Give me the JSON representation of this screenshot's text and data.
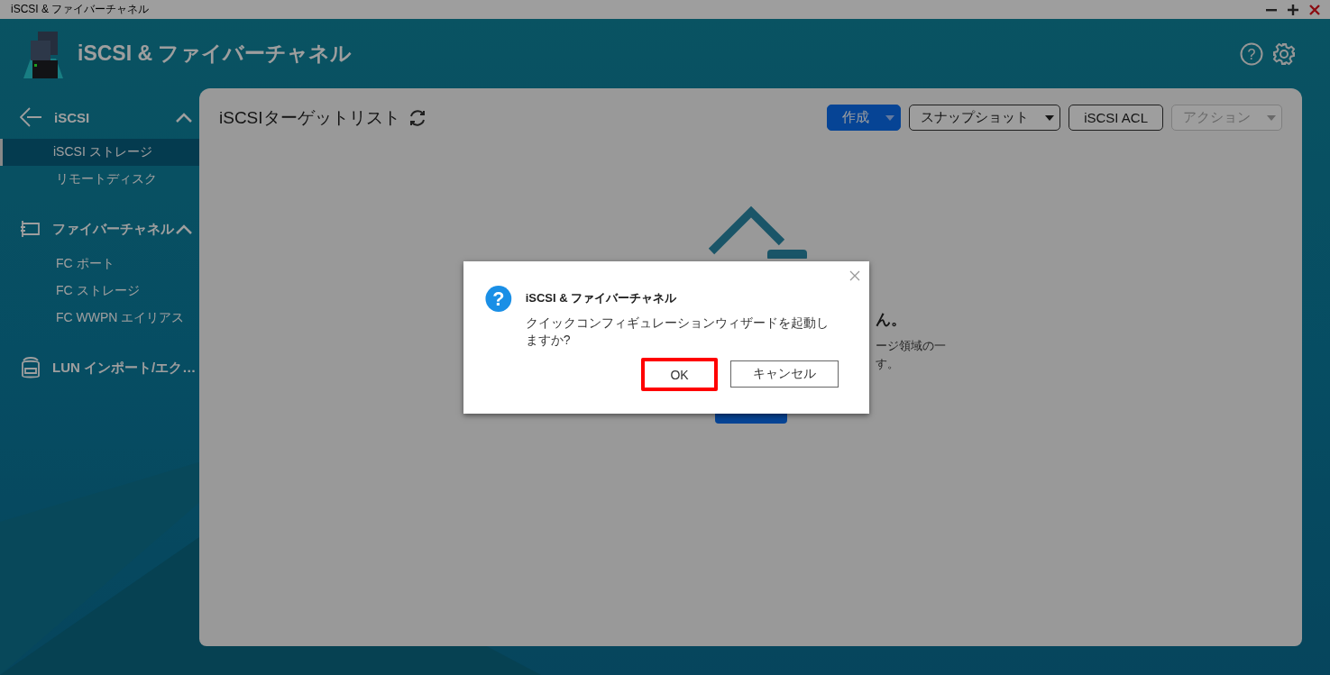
{
  "window": {
    "title": "iSCSI & ファイバーチャネル"
  },
  "app_header": {
    "title": "iSCSI & ファイバーチャネル",
    "help_glyph": "?"
  },
  "sidebar": {
    "groups": [
      {
        "label": "iSCSI",
        "expanded": true,
        "items": [
          {
            "label": "iSCSI ストレージ",
            "selected": true
          },
          {
            "label": "リモートディスク",
            "selected": false
          }
        ]
      },
      {
        "label": "ファイバーチャネル",
        "expanded": true,
        "items": [
          {
            "label": "FC ポート",
            "selected": false
          },
          {
            "label": "FC ストレージ",
            "selected": false
          },
          {
            "label": "FC WWPN エイリアス",
            "selected": false
          }
        ]
      },
      {
        "label": "LUN インポート/エク…"
      }
    ]
  },
  "panel": {
    "title": "iSCSIターゲットリスト",
    "toolbar": [
      {
        "label": "作成",
        "kind": "split",
        "disabled": false
      },
      {
        "label": "スナップショット",
        "kind": "dropdown",
        "disabled": false
      },
      {
        "label": "iSCSI ACL",
        "kind": "plain",
        "disabled": false
      },
      {
        "label": "アクション",
        "kind": "dropdown",
        "disabled": true
      }
    ],
    "empty_state": {
      "heading": "ん。",
      "description": [
        "ージ領域の一",
        "す。"
      ]
    }
  },
  "dialog": {
    "icon_glyph": "?",
    "title": "iSCSI & ファイバーチャネル",
    "message": "クイックコンフィギュレーションウィザードを起動しますか?",
    "buttons": [
      {
        "label": "OK",
        "kind": "primary",
        "highlighted": true
      },
      {
        "label": "キャンセル",
        "kind": "secondary",
        "highlighted": false
      }
    ]
  }
}
